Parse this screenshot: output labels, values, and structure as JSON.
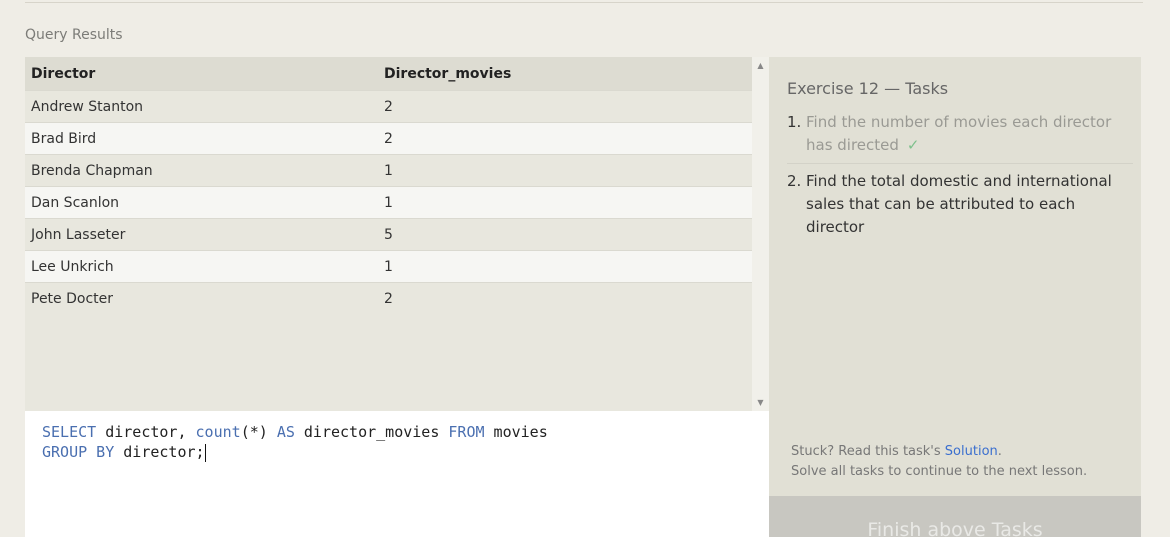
{
  "section_title": "Query Results",
  "table": {
    "columns": [
      "Director",
      "Director_movies"
    ],
    "rows": [
      [
        "Andrew Stanton",
        "2"
      ],
      [
        "Brad Bird",
        "2"
      ],
      [
        "Brenda Chapman",
        "1"
      ],
      [
        "Dan Scanlon",
        "1"
      ],
      [
        "John Lasseter",
        "5"
      ],
      [
        "Lee Unkrich",
        "1"
      ],
      [
        "Pete Docter",
        "2"
      ]
    ]
  },
  "editor": {
    "line1": {
      "kw1": "SELECT",
      "t1": " director, ",
      "kw2": "count",
      "t2": "(*) ",
      "kw3": "AS",
      "t3": " director_movies ",
      "kw4": "FROM",
      "t4": " movies"
    },
    "line2": {
      "kw1": "GROUP BY",
      "t1": " director;"
    }
  },
  "tasks": {
    "title": "Exercise 12 — Tasks",
    "items": [
      {
        "num": "1.",
        "text": "Find the number of movies each director has directed",
        "check": "✓"
      },
      {
        "num": "2.",
        "text": "Find the total domestic and international sales that can be attributed to each director"
      }
    ],
    "hint_prefix": "Stuck? Read this task's ",
    "hint_link": "Solution",
    "hint_suffix": ".",
    "hint_line2": "Solve all tasks to continue to the next lesson."
  },
  "finish_button": "Finish above Tasks",
  "colors": {
    "accent_link": "#3b6fcf",
    "keyword": "#4a6fb0",
    "check": "#7ec08c"
  },
  "icons": {
    "scroll_up": "triangle-up-icon",
    "scroll_down": "triangle-down-icon",
    "check": "checkmark-icon"
  }
}
